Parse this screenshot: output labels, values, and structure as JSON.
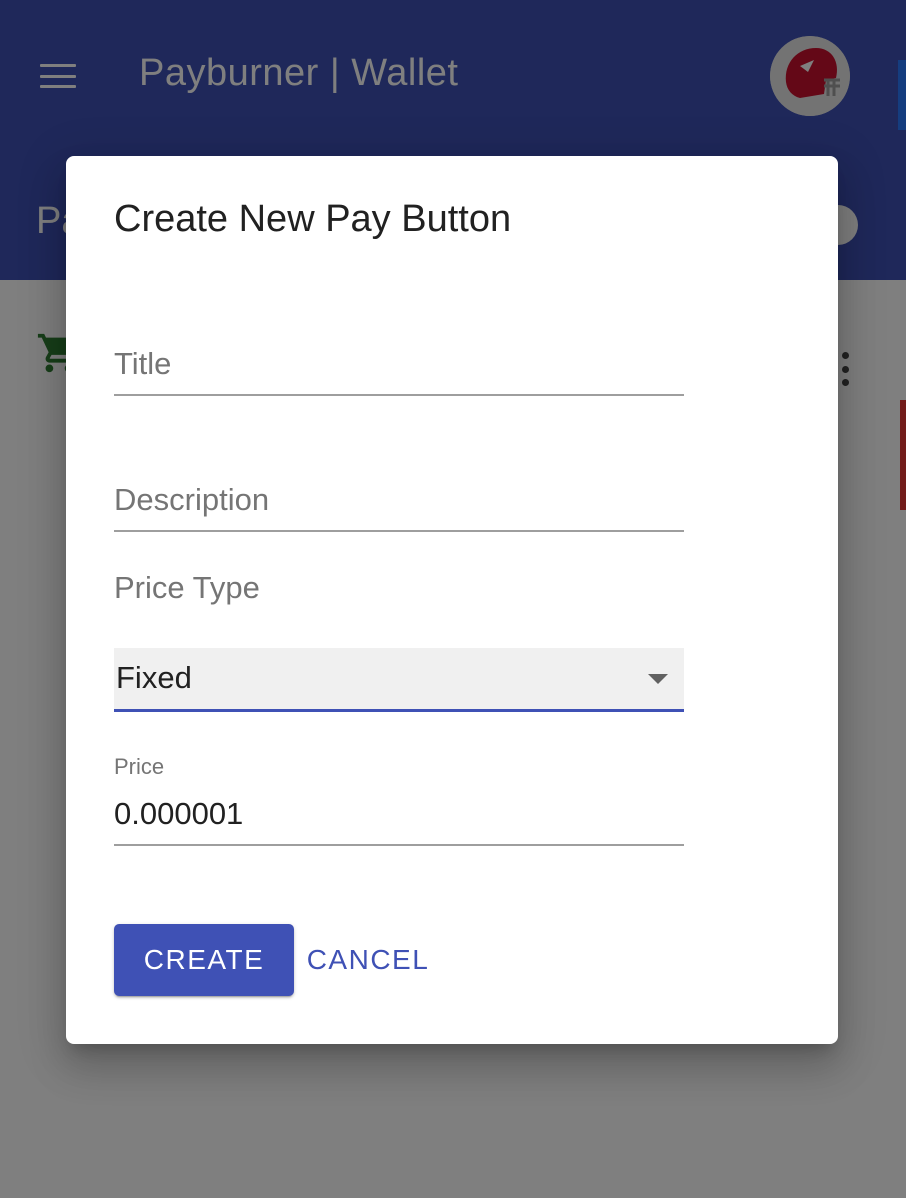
{
  "app": {
    "title": "Payburner | Wallet",
    "page_title": "Pa"
  },
  "dialog": {
    "title": "Create New Pay Button",
    "fields": {
      "title_placeholder": "Title",
      "description_placeholder": "Description",
      "price_type_label": "Price Type",
      "price_type_value": "Fixed",
      "price_label": "Price",
      "price_value": "0.000001"
    },
    "buttons": {
      "create": "CREATE",
      "cancel": "CANCEL"
    }
  },
  "colors": {
    "primary": "#3f51b5",
    "scrim": "rgba(0,0,0,0.5)"
  },
  "icons": {
    "menu": "menu-icon",
    "avatar": "chiefs-helmet-avatar",
    "cart": "shopping-cart-icon",
    "more": "more-vertical-icon",
    "dropdown": "chevron-down-icon"
  }
}
